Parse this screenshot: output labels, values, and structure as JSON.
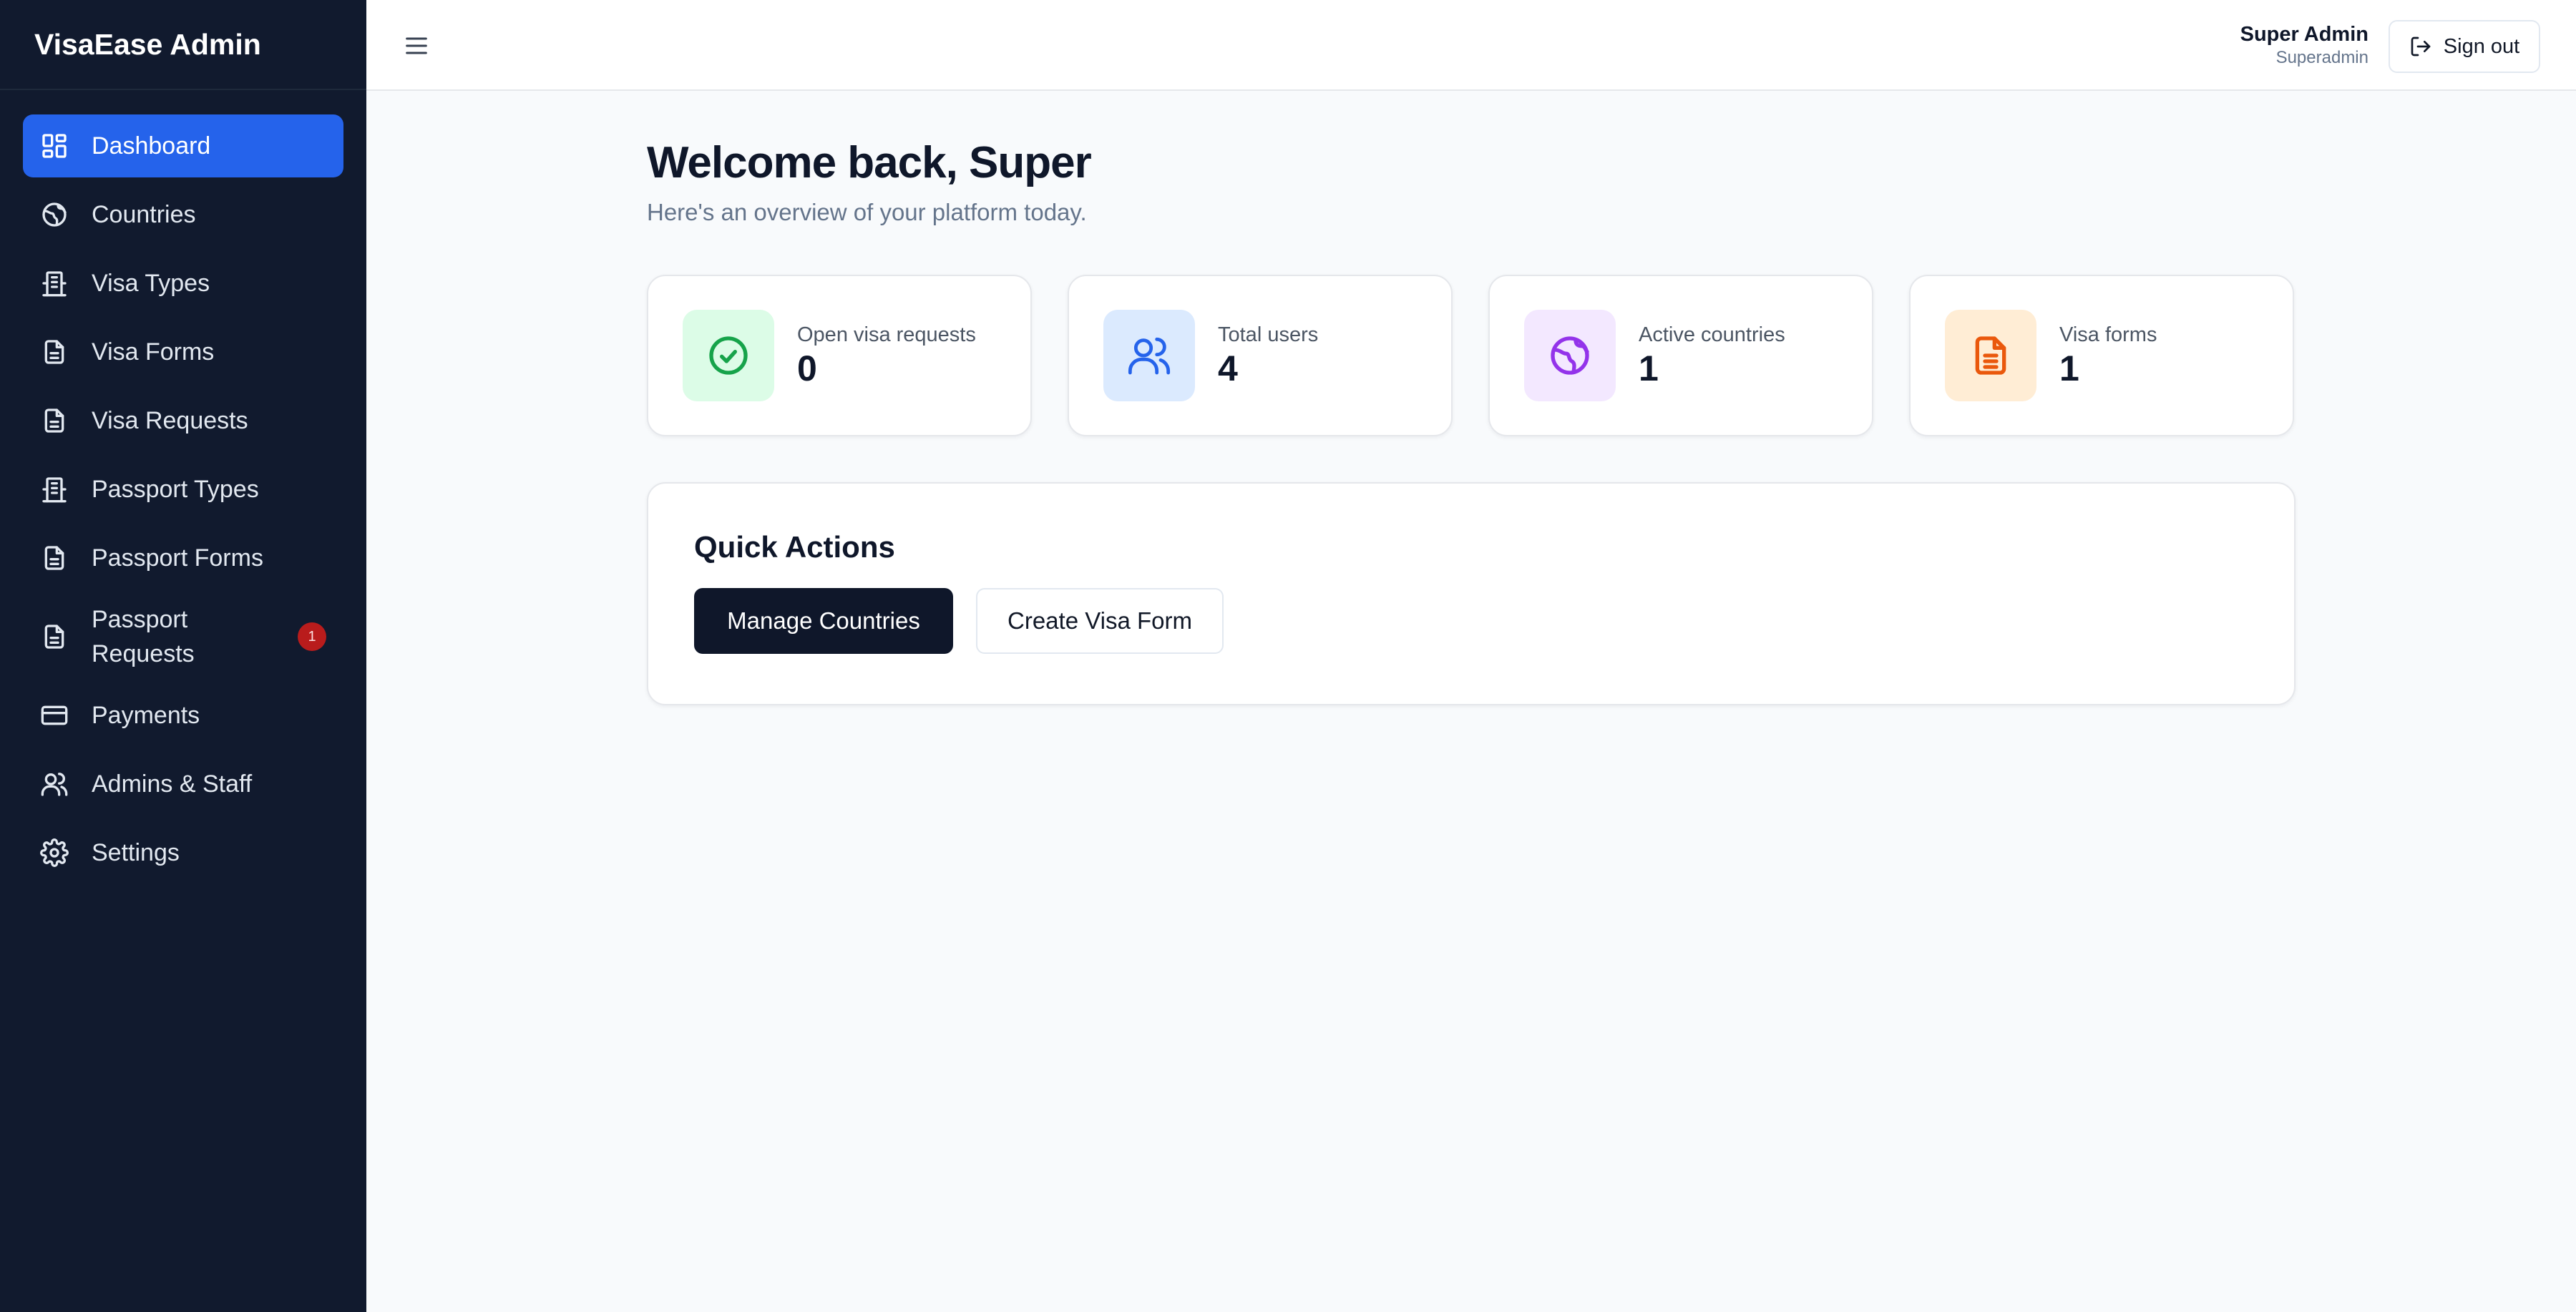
{
  "brand": "VisaEase Admin",
  "sidebar": {
    "items": [
      {
        "label": "Dashboard",
        "icon": "dashboard-icon",
        "active": true
      },
      {
        "label": "Countries",
        "icon": "globe-icon"
      },
      {
        "label": "Visa Types",
        "icon": "building-icon"
      },
      {
        "label": "Visa Forms",
        "icon": "document-icon"
      },
      {
        "label": "Visa Requests",
        "icon": "document-icon"
      },
      {
        "label": "Passport Types",
        "icon": "building-icon"
      },
      {
        "label": "Passport Forms",
        "icon": "document-icon"
      },
      {
        "label": "Passport Requests",
        "icon": "document-icon",
        "badge": "1"
      },
      {
        "label": "Payments",
        "icon": "credit-card-icon"
      },
      {
        "label": "Admins & Staff",
        "icon": "users-icon"
      },
      {
        "label": "Settings",
        "icon": "gear-icon"
      }
    ]
  },
  "header": {
    "menu_icon": "hamburger-menu-icon",
    "user_name": "Super Admin",
    "user_role": "Superadmin",
    "signout_label": "Sign out"
  },
  "main": {
    "title": "Welcome back, Super",
    "subtitle": "Here's an overview of your platform today."
  },
  "stats": [
    {
      "label": "Open visa requests",
      "value": "0",
      "icon": "check-circle-icon",
      "color": "#16a34a",
      "bg": "#dcfce7"
    },
    {
      "label": "Total users",
      "value": "4",
      "icon": "users-icon",
      "color": "#2563eb",
      "bg": "#dbeafe"
    },
    {
      "label": "Active countries",
      "value": "1",
      "icon": "globe-icon",
      "color": "#9333ea",
      "bg": "#f3e8ff"
    },
    {
      "label": "Visa forms",
      "value": "1",
      "icon": "document-icon",
      "color": "#ea580c",
      "bg": "#ffedd5"
    }
  ],
  "quick_actions": {
    "title": "Quick Actions",
    "primary_label": "Manage Countries",
    "secondary_label": "Create Visa Form"
  },
  "colors": {
    "sidebar_bg": "#111a2e",
    "accent": "#2563eb",
    "badge": "#b91c1c"
  }
}
